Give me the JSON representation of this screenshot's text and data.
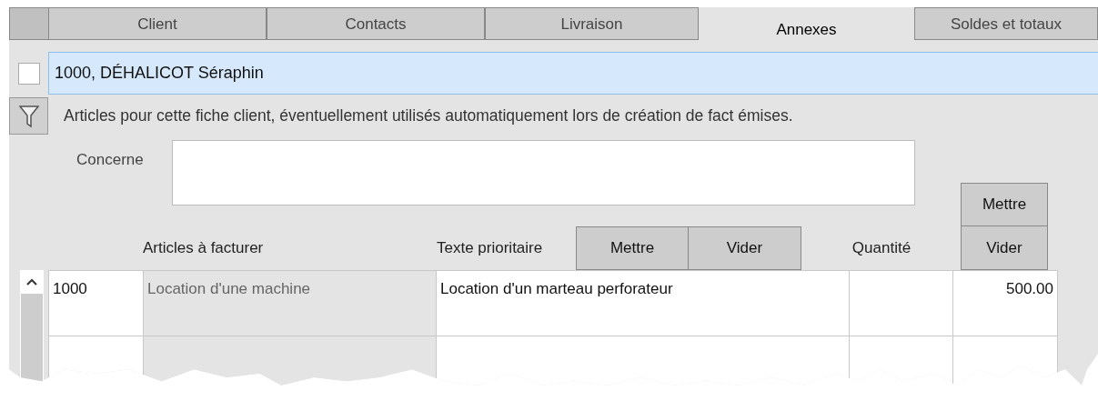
{
  "tabs": [
    {
      "label": "Client",
      "selected": false
    },
    {
      "label": "Contacts",
      "selected": false
    },
    {
      "label": "Livraison",
      "selected": false
    },
    {
      "label": "Annexes",
      "selected": true
    },
    {
      "label": "Soldes et totaux",
      "selected": false
    }
  ],
  "record": {
    "checked": false,
    "title": "1000, DÉHALICOT Séraphin"
  },
  "description": "Articles pour cette fiche client, éventuellement utilisés automatiquement lors de création de fact émises.",
  "concerne": {
    "label": "Concerne"
  },
  "headers": {
    "articles": "Articles à facturer",
    "priority_text": "Texte prioritaire",
    "priority_buttons": [
      "Mettre",
      "Vider"
    ],
    "quantity": "Quantité",
    "amount_buttons": [
      "Mettre",
      "Vider"
    ]
  },
  "rows": [
    {
      "code": "1000",
      "article": "Location d'une machine",
      "text": "Location d'un marteau perforateur",
      "amount": "500.00"
    }
  ]
}
